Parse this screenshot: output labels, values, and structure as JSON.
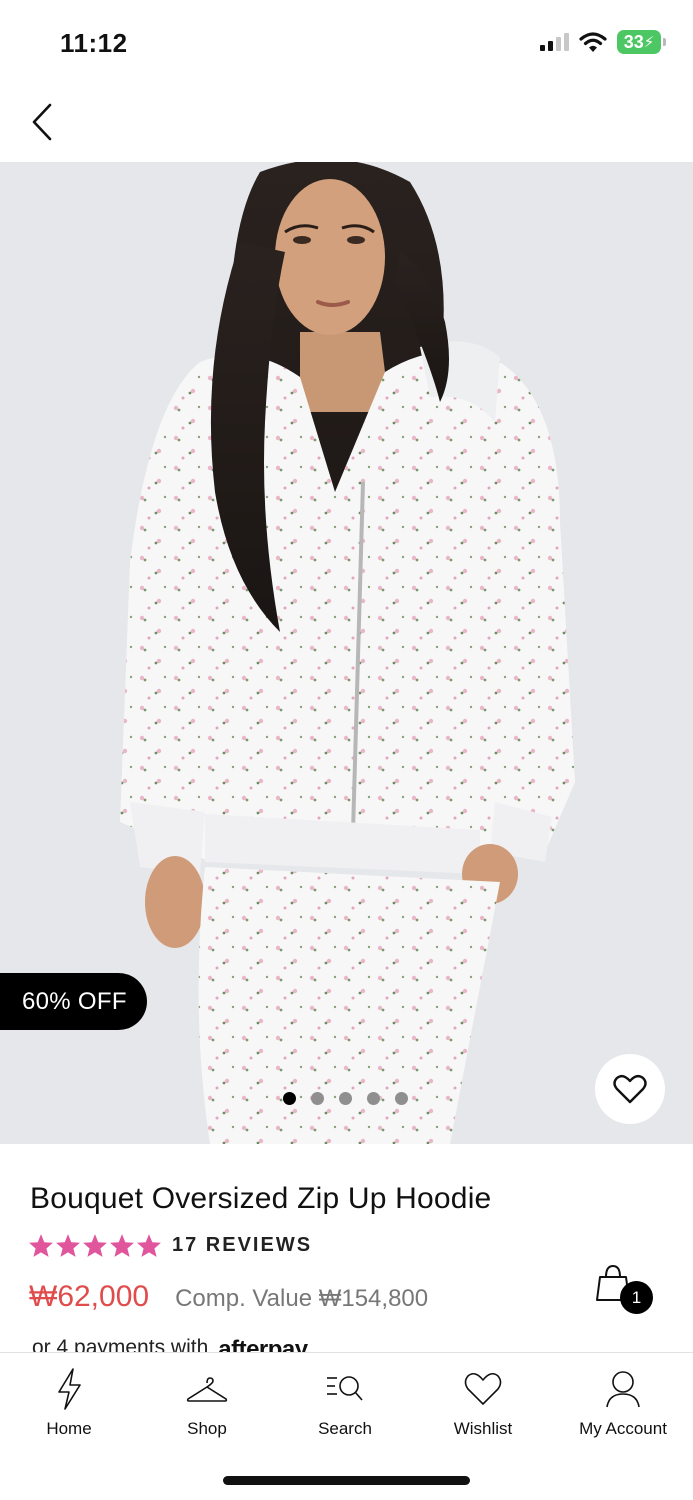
{
  "status_bar": {
    "time": "11:12",
    "battery_level": "33",
    "battery_color": "#4cc764"
  },
  "nav": {
    "back_icon": "chevron-left-icon"
  },
  "gallery": {
    "discount_label": "60% OFF",
    "image_count": 5,
    "active_index": 0,
    "wishlist_icon": "heart-icon"
  },
  "product": {
    "title": "Bouquet Oversized Zip Up Hoodie",
    "rating_stars": 5,
    "star_color": "#e0559c",
    "reviews_label": "17 REVIEWS",
    "price": "₩62,000",
    "price_color": "#e04b4b",
    "comp_value": "Comp. Value ₩154,800",
    "cart_count": "1",
    "afterpay_text": "or 4 payments with",
    "afterpay_logo": "afterpay"
  },
  "tab_bar": {
    "tabs": [
      {
        "label": "Home",
        "icon": "lightning-icon"
      },
      {
        "label": "Shop",
        "icon": "hanger-icon"
      },
      {
        "label": "Search",
        "icon": "search-list-icon"
      },
      {
        "label": "Wishlist",
        "icon": "heart-icon"
      },
      {
        "label": "My Account",
        "icon": "user-icon"
      }
    ]
  }
}
